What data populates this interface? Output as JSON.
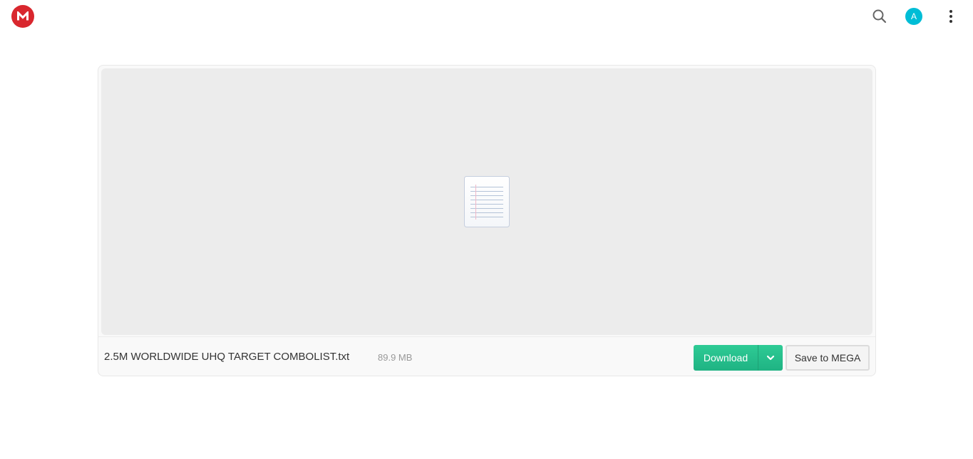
{
  "header": {
    "logo_letter": "M",
    "logo_color": "#d9272e",
    "search_icon": "search-icon",
    "avatar_initial": "A",
    "avatar_color": "#00bdd6",
    "menu_icon": "more-vertical-icon"
  },
  "file": {
    "name": "2.5M WORLDWIDE UHQ TARGET COMBOLIST.txt",
    "size": "89.9 MB",
    "preview_icon": "text-document-icon"
  },
  "actions": {
    "download_label": "Download",
    "download_color": "#27c08b",
    "dropdown_icon": "chevron-down-icon",
    "save_label": "Save to MEGA"
  }
}
